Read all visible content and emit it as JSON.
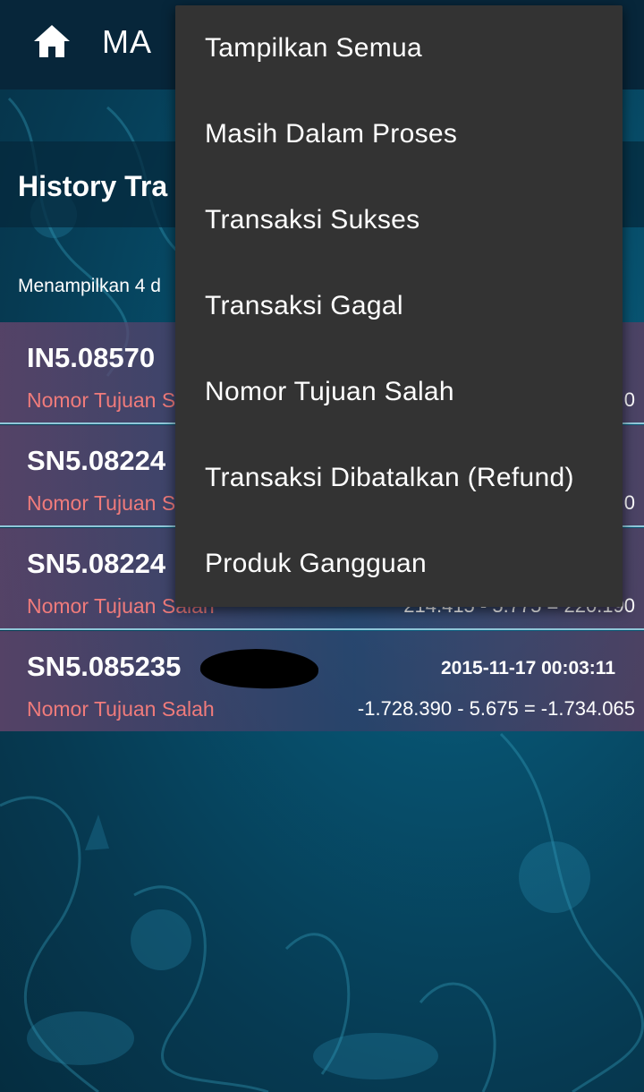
{
  "action_bar": {
    "title": "MA"
  },
  "page": {
    "title": "History Tra",
    "showing_text": "Menampilkan 4 d"
  },
  "transactions": [
    {
      "id": "IN5.08570",
      "status": "Nomor Tujuan S",
      "date": "",
      "amount": "0"
    },
    {
      "id": "SN5.08224",
      "status": "Nomor Tujuan S",
      "date": "",
      "amount": "0"
    },
    {
      "id": "SN5.08224",
      "status": "Nomor Tujuan Salah",
      "date": "",
      "amount": "214.415 - 5.775 = 220.190"
    },
    {
      "id": "SN5.085235",
      "status": "Nomor Tujuan Salah",
      "date": "2015-11-17 00:03:11",
      "amount": "-1.728.390 - 5.675 = -1.734.065"
    }
  ],
  "menu": {
    "items": [
      "Tampilkan Semua",
      "Masih Dalam Proses",
      "Transaksi Sukses",
      "Transaksi Gagal",
      "Nomor Tujuan Salah",
      "Transaksi Dibatalkan (Refund)",
      "Produk Gangguan"
    ]
  },
  "colors": {
    "action_bar": "#07263a",
    "status_error": "#f07b7b",
    "menu_bg": "#333333"
  }
}
